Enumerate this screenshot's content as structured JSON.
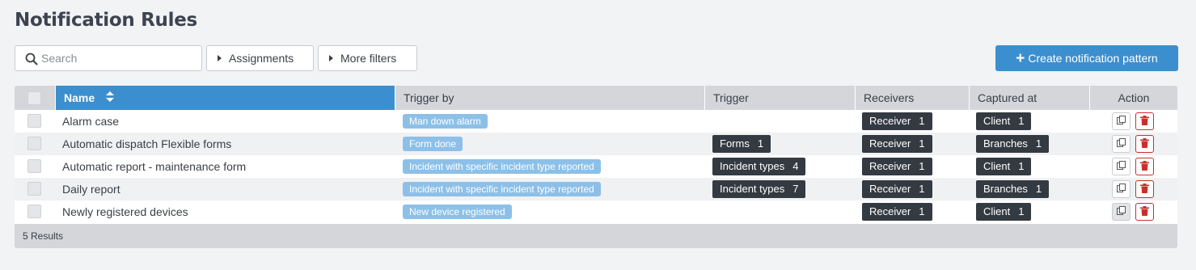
{
  "page": {
    "title": "Notification Rules"
  },
  "search": {
    "placeholder": "Search"
  },
  "filters": {
    "assignments": "Assignments",
    "more_filters": "More filters"
  },
  "create_button": {
    "label": "Create notification pattern"
  },
  "colors": {
    "accent": "#3c8fce",
    "tag_blue": "#8cc0e8",
    "tag_dark": "#343a42",
    "delete": "#c9302c"
  },
  "table": {
    "headers": {
      "name": "Name",
      "trigger_by": "Trigger by",
      "trigger": "Trigger",
      "receivers": "Receivers",
      "captured_at": "Captured at",
      "action": "Action"
    },
    "rows": [
      {
        "name": "Alarm case",
        "trigger_by": "Man down alarm",
        "trigger": null,
        "receivers": {
          "label": "Receiver",
          "count": "1"
        },
        "captured_at": {
          "label": "Client",
          "count": "1"
        }
      },
      {
        "name": "Automatic dispatch Flexible forms",
        "trigger_by": "Form done",
        "trigger": {
          "label": "Forms",
          "count": "1"
        },
        "receivers": {
          "label": "Receiver",
          "count": "1"
        },
        "captured_at": {
          "label": "Branches",
          "count": "1"
        }
      },
      {
        "name": "Automatic report - maintenance form",
        "trigger_by": "Incident with specific incident type reported",
        "trigger": {
          "label": "Incident types",
          "count": "4"
        },
        "receivers": {
          "label": "Receiver",
          "count": "1"
        },
        "captured_at": {
          "label": "Client",
          "count": "1"
        }
      },
      {
        "name": "Daily report",
        "trigger_by": "Incident with specific incident type reported",
        "trigger": {
          "label": "Incident types",
          "count": "7"
        },
        "receivers": {
          "label": "Receiver",
          "count": "1"
        },
        "captured_at": {
          "label": "Branches",
          "count": "1"
        }
      },
      {
        "name": "Newly registered devices",
        "trigger_by": "New device registered",
        "trigger": null,
        "receivers": {
          "label": "Receiver",
          "count": "1"
        },
        "captured_at": {
          "label": "Client",
          "count": "1"
        }
      }
    ],
    "footer": "5 Results"
  }
}
